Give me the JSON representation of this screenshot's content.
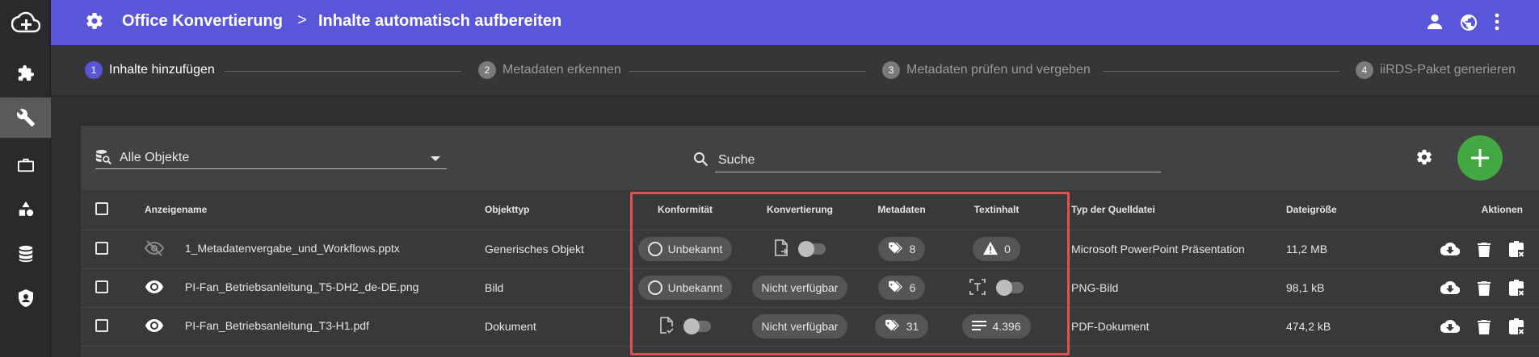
{
  "header": {
    "title": "Office Konvertierung",
    "separator": ">",
    "subtitle": "Inhalte automatisch aufbereiten"
  },
  "sidebar": {
    "items": [
      {
        "icon": "cloud-add-icon"
      },
      {
        "icon": "puzzle-icon"
      },
      {
        "icon": "wrench-icon",
        "active": true
      },
      {
        "icon": "briefcase-icon"
      },
      {
        "icon": "shapes-icon"
      },
      {
        "icon": "database-icon"
      },
      {
        "icon": "shield-icon"
      }
    ]
  },
  "stepper": {
    "steps": [
      {
        "num": "1",
        "label": "Inhalte hinzufügen",
        "active": true
      },
      {
        "num": "2",
        "label": "Metadaten erkennen"
      },
      {
        "num": "3",
        "label": "Metadaten prüfen und vergeben"
      },
      {
        "num": "4",
        "label": "iiRDS-Paket generieren"
      }
    ]
  },
  "toolbar": {
    "filter_value": "Alle Objekte",
    "search_placeholder": "Suche"
  },
  "table": {
    "headers": {
      "name": "Anzeigename",
      "type": "Objekttyp",
      "conformity": "Konformität",
      "conversion": "Konvertierung",
      "metadata": "Metadaten",
      "textcontent": "Textinhalt",
      "source_type": "Typ der Quelldatei",
      "size": "Dateigröße",
      "actions": "Aktionen"
    },
    "rows": [
      {
        "name": "1_Metadatenvergabe_und_Workflows.pptx",
        "visible": false,
        "type": "Generisches Objekt",
        "conformity": "Unbekannt",
        "conversion": "toggle",
        "metadata": "8",
        "textcontent": "0",
        "source_type": "Microsoft PowerPoint Präsentation",
        "size": "11,2 MB"
      },
      {
        "name": "PI-Fan_Betriebsanleitung_T5-DH2_de-DE.png",
        "visible": true,
        "type": "Bild",
        "conformity": "Unbekannt",
        "conversion": "Nicht verfügbar",
        "metadata": "6",
        "textcontent": "toggle",
        "source_type": "PNG-Bild",
        "size": "98,1 kB"
      },
      {
        "name": "PI-Fan_Betriebsanleitung_T3-H1.pdf",
        "visible": true,
        "type": "Dokument",
        "conformity": "toggle",
        "conversion": "Nicht verfügbar",
        "metadata": "31",
        "textcontent": "4.396",
        "source_type": "PDF-Dokument",
        "size": "474,2 kB"
      }
    ]
  },
  "colors": {
    "primary": "#5a56d9",
    "fab": "#43a843",
    "highlight": "#e05252"
  }
}
